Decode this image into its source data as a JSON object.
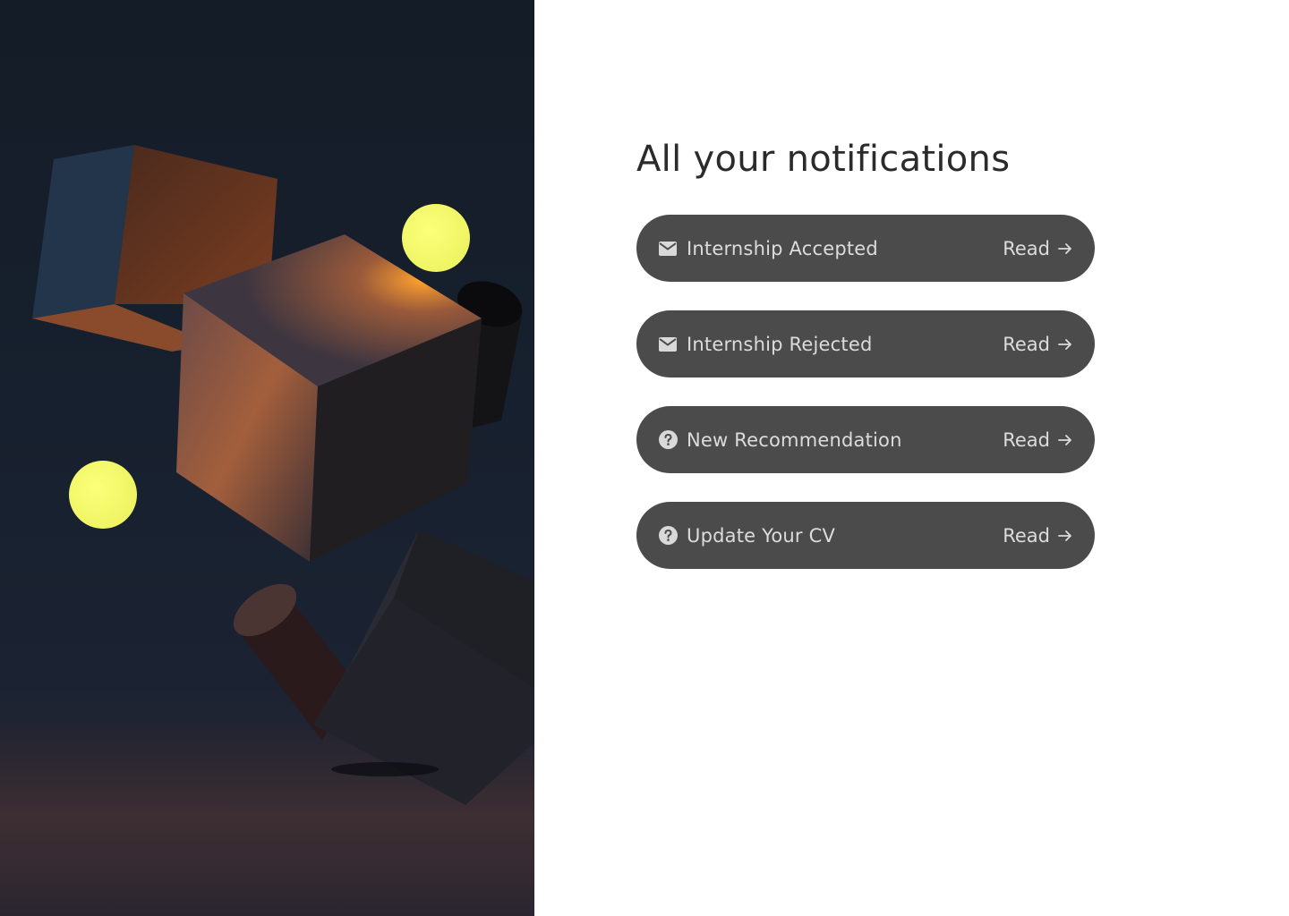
{
  "page": {
    "title": "All your notifications"
  },
  "notifications": [
    {
      "label": "Internship Accepted",
      "icon": "mail-icon",
      "action": "Read"
    },
    {
      "label": "Internship Rejected",
      "icon": "mail-icon",
      "action": "Read"
    },
    {
      "label": "New Recommendation",
      "icon": "help-circle-icon",
      "action": "Read"
    },
    {
      "label": "Update Your CV",
      "icon": "help-circle-icon",
      "action": "Read"
    }
  ],
  "colors": {
    "background": "#ffffff",
    "title_text": "#2b2b2b",
    "card_background": "#4b4b4b",
    "card_text": "#dcdcdc",
    "hero_background": "#17202e",
    "sphere": "#f7fb6a",
    "cube_glow": "#ff9a2e"
  }
}
